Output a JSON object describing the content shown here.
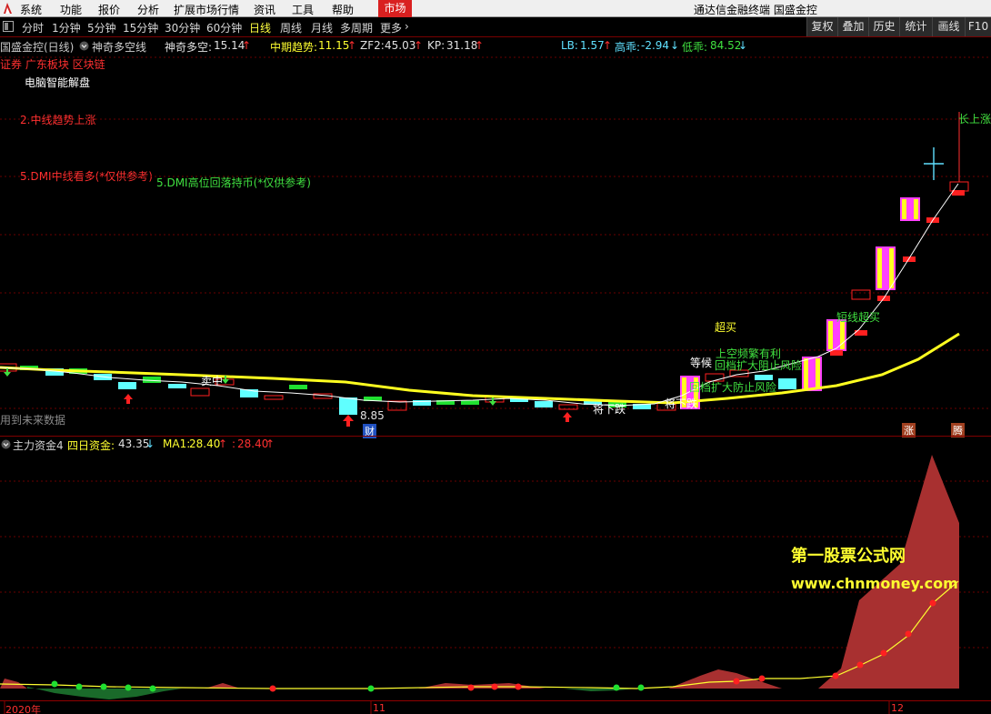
{
  "menubar": {
    "items": [
      "系统",
      "功能",
      "报价",
      "分析",
      "扩展市场行情",
      "资讯",
      "工具",
      "帮助"
    ],
    "market_button": "市场",
    "app_title": "通达信金融终端  国盛金控"
  },
  "periodbar": {
    "periods": [
      "分时",
      "1分钟",
      "5分钟",
      "15分钟",
      "30分钟",
      "60分钟",
      "日线",
      "周线",
      "月线",
      "多周期",
      "更多"
    ],
    "active": "日线",
    "tools": [
      "复权",
      "叠加",
      "历史",
      "统计",
      "画线",
      "F10"
    ]
  },
  "main_panel": {
    "stock_title": "国盛金控(日线)",
    "indicator_name": "神奇多空线",
    "readouts": [
      {
        "label": "神奇多空:",
        "value": "15.14",
        "arrow": "↑"
      },
      {
        "label": "中期趋势:",
        "value": "11.15",
        "arrow": "↑"
      },
      {
        "label": "ZF2:",
        "value": "45.03",
        "arrow": "↑"
      },
      {
        "label": "KP:",
        "value": "31.18",
        "arrow": "↑"
      },
      {
        "label": "LB:",
        "value": "1.57",
        "arrow": "↑"
      },
      {
        "label": "高乖:",
        "value": "-2.94",
        "arrow": "↓"
      },
      {
        "label": "低乖:",
        "value": "84.52",
        "arrow": "↓"
      }
    ],
    "tags": "证券 广东板块 区块链",
    "ai_label": "电脑智能解盘",
    "notes": [
      "2.中线趋势上涨",
      "5.DMI中线看多(*仅供参考)",
      "5.DMI高位回落持币(*仅供参考)"
    ],
    "future_data_note": "用到未来数据",
    "low_price": "8.85",
    "finance_badge": "财",
    "annotations": {
      "sell_mid": "卖中",
      "overbuy": "超买",
      "short_overbuy": "短线超买",
      "up_trend": "长上涨势",
      "drop": "将下跌",
      "drop2": "将下跌",
      "wait": "等候",
      "green_1": "上空频繁有利",
      "green_2": "回档扩大阻止风险",
      "green_3": "回档扩大防止风险"
    },
    "right_badges": [
      "涨",
      "腾"
    ],
    "colors": {
      "up": "#ff2020",
      "down": "#20e030",
      "cyan": "#60ffff",
      "line": "#ffff20",
      "magenta": "#ff40ff"
    }
  },
  "sub_panel": {
    "indicator_name": "主力资金4",
    "readouts": [
      {
        "label": "四日资金:",
        "value": "43.35",
        "arrow": "↓"
      },
      {
        "label": "MA1:",
        "value": "28.40",
        "arrow": "↑"
      },
      {
        "label": ":",
        "value": "28.40",
        "arrow": "↑"
      }
    ],
    "watermark_title": "第一股票公式网",
    "watermark_url": "www.chnmoney.com"
  },
  "time_axis": {
    "labels": [
      "2020年",
      "11",
      "12"
    ]
  }
}
